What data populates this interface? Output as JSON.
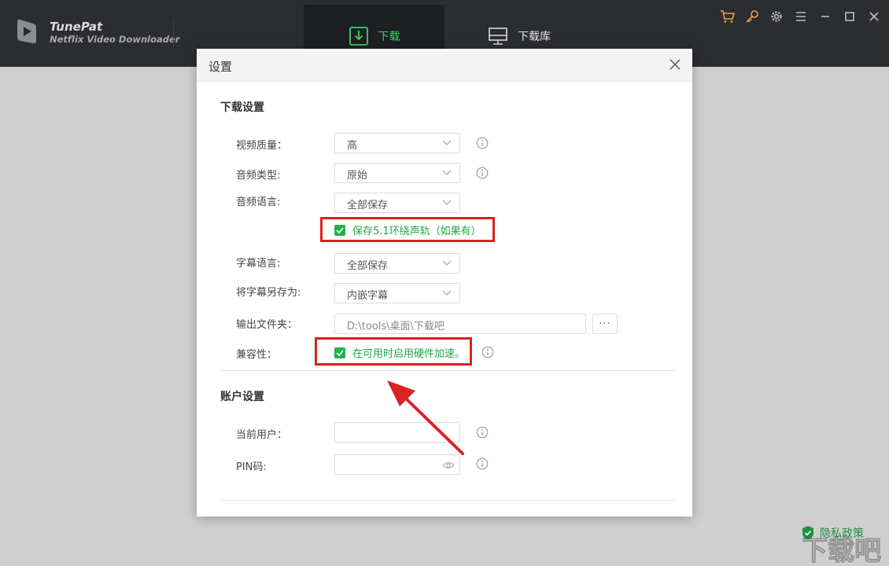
{
  "app": {
    "name": "TunePat",
    "subtitle": "Netflix Video Downloader"
  },
  "nav": {
    "download_label": "下载",
    "library_label": "下载库"
  },
  "window_icons": [
    "cart-icon",
    "key-icon",
    "gear-icon",
    "menu-icon",
    "minimize-icon",
    "maximize-icon",
    "close-icon"
  ],
  "dialog": {
    "title": "设置",
    "download_section": {
      "title": "下载设置",
      "video_quality": {
        "label": "视频质量：",
        "value": "高"
      },
      "audio_type": {
        "label": "音频类型:",
        "value": "原始"
      },
      "audio_language": {
        "label": "音频语言:",
        "value": "全部保存"
      },
      "surround_checkbox": {
        "label": "保存5.1环绕声轨（如果有）",
        "checked": true
      },
      "subtitle_language": {
        "label": "字幕语言:",
        "value": "全部保存"
      },
      "save_subtitles_as": {
        "label": "将字幕另存为:",
        "value": "内嵌字幕"
      },
      "output_folder": {
        "label": "输出文件夹：",
        "value": "D:\\tools\\桌面\\下载吧",
        "browse": "···"
      },
      "compatibility": {
        "label": "兼容性：",
        "checkbox_label": "在可用时启用硬件加速。",
        "checked": true
      }
    },
    "account_section": {
      "title": "账户设置",
      "current_user": {
        "label": "当前用户：",
        "value": ""
      },
      "pin": {
        "label": "PIN码:",
        "value": ""
      }
    }
  },
  "footer": {
    "privacy_label": "隐私政策",
    "watermark_text": "下载吧"
  },
  "colors": {
    "titlebar": "#2b2d31",
    "accent_green": "#3fcf6a",
    "checkbox_green": "#22b24c",
    "highlight_red": "#d92222",
    "window_icon_orange": "#e8a33a"
  }
}
